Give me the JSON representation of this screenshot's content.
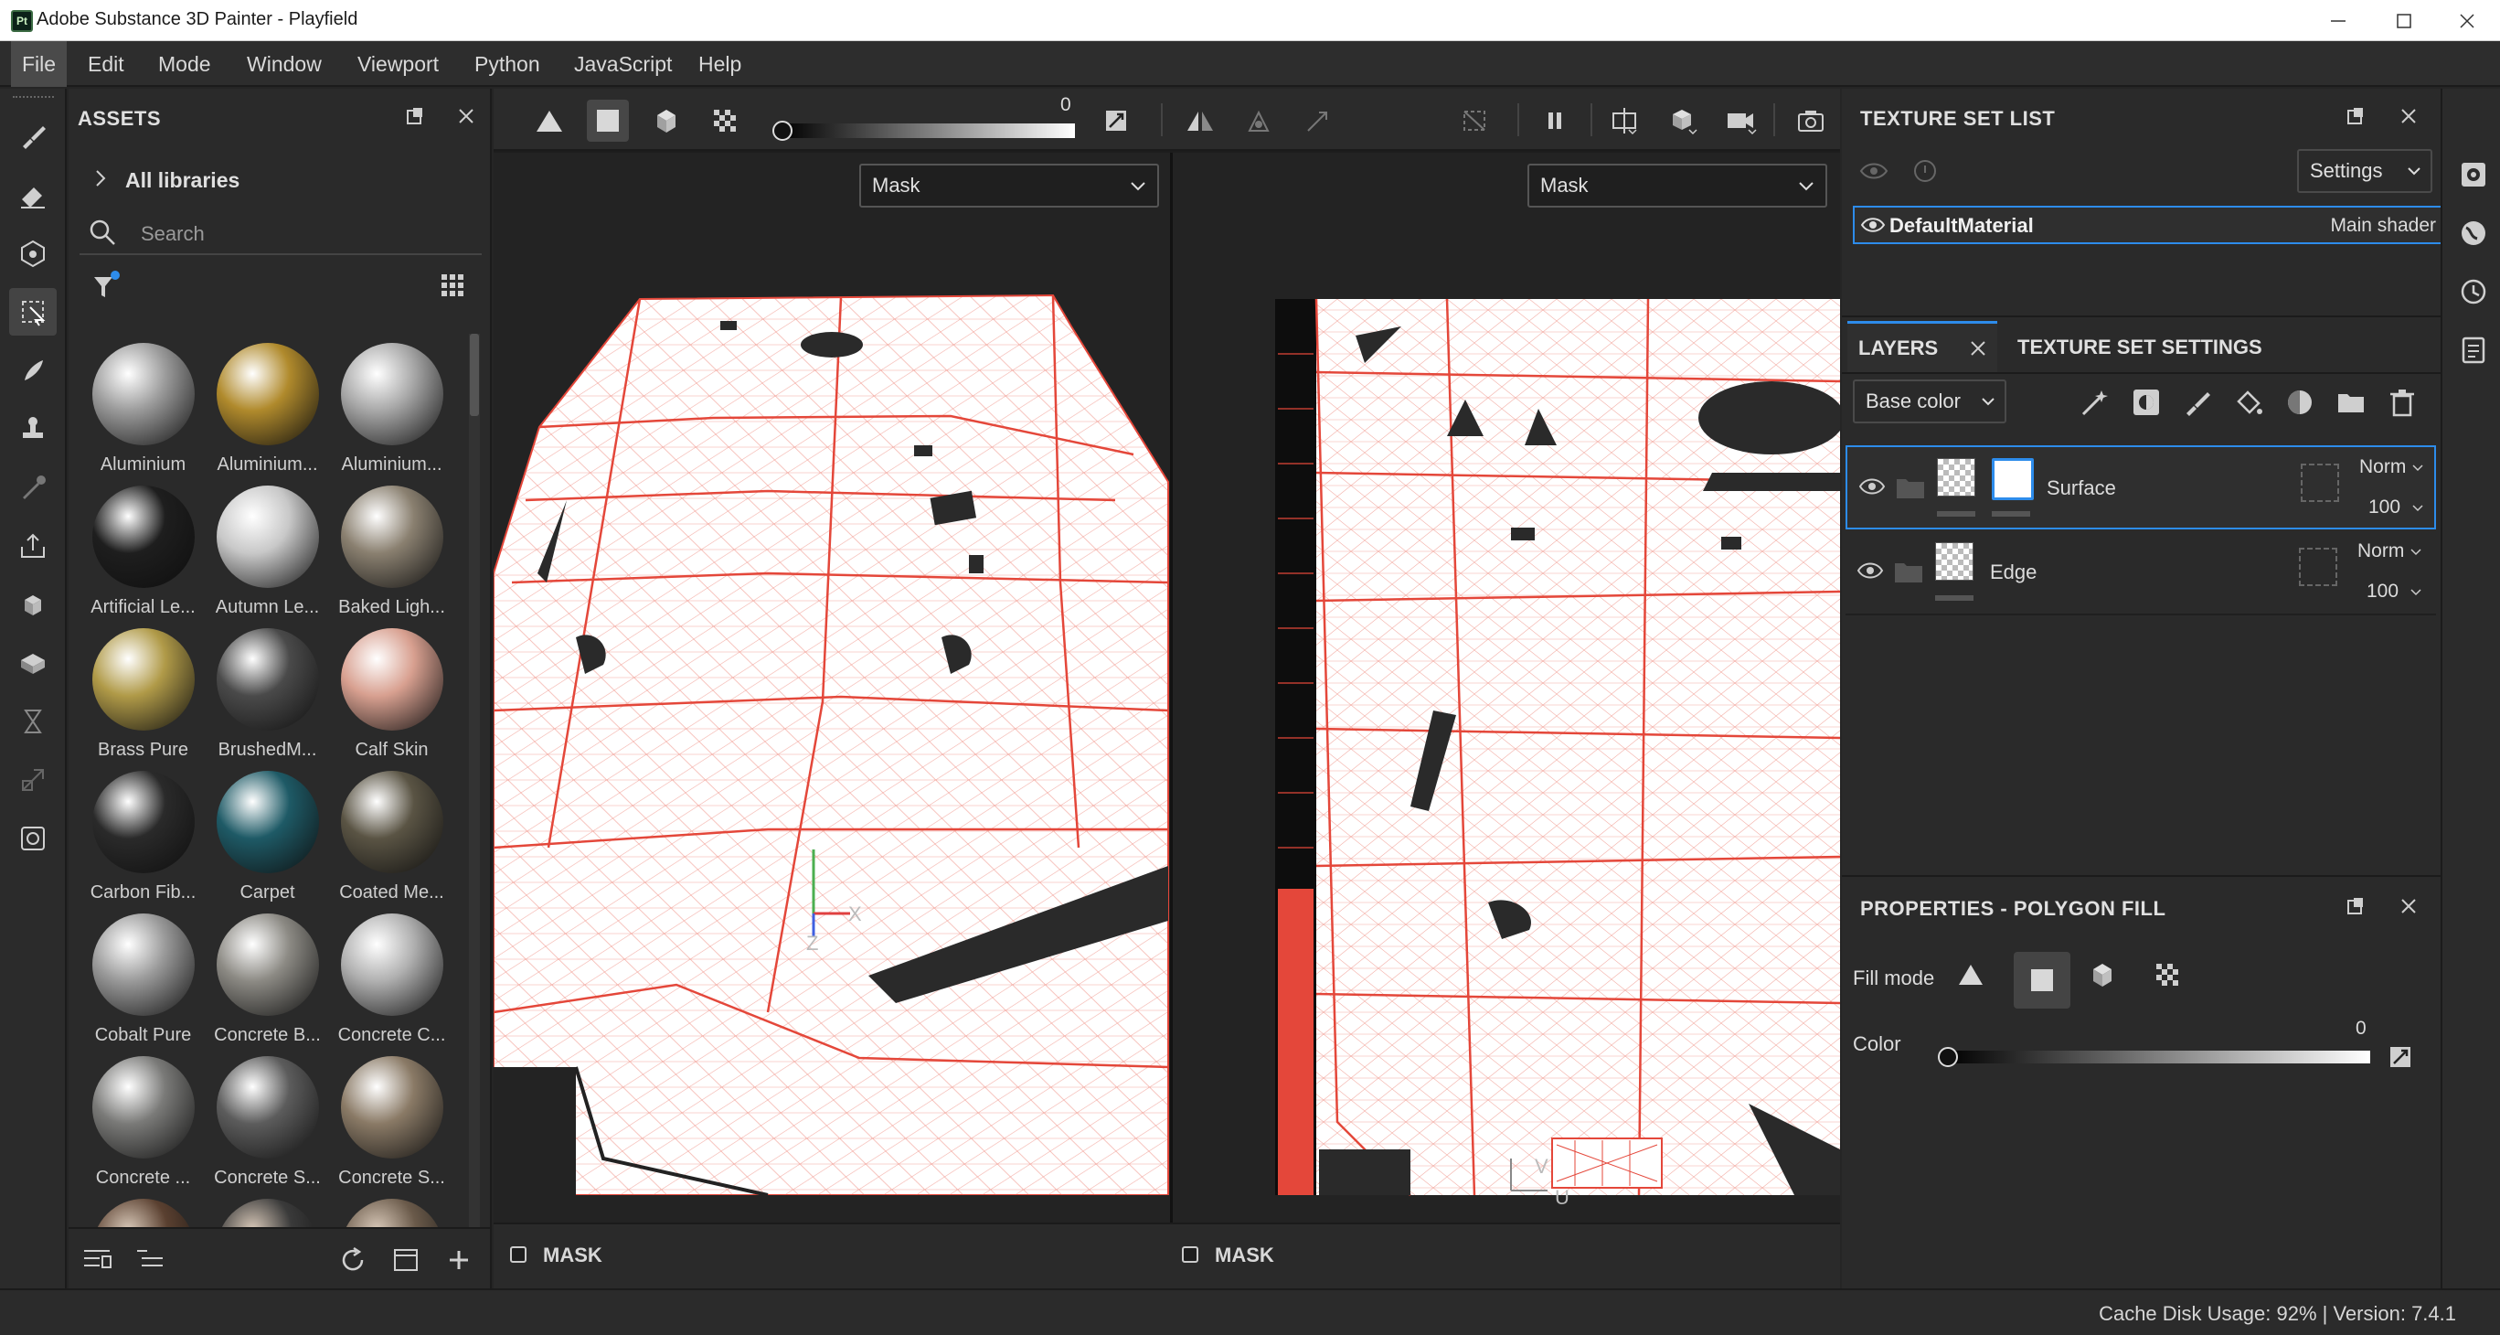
{
  "window": {
    "title": "Adobe Substance 3D Painter - Playfield",
    "app_icon_text": "Pt"
  },
  "menu": [
    "File",
    "Edit",
    "Mode",
    "Window",
    "Viewport",
    "Python",
    "JavaScript",
    "Help"
  ],
  "assets": {
    "title": "ASSETS",
    "libraries_label": "All libraries",
    "search_placeholder": "Search",
    "materials": [
      {
        "name": "Aluminium",
        "color": "#9c9c9c"
      },
      {
        "name": "Aluminium...",
        "color": "#b08a2c"
      },
      {
        "name": "Aluminium...",
        "color": "#a8a8a8"
      },
      {
        "name": "Artificial Le...",
        "color": "#1e1e1e"
      },
      {
        "name": "Autumn Le...",
        "color": "#c8c8c8"
      },
      {
        "name": "Baked Ligh...",
        "color": "#8a8070"
      },
      {
        "name": "Brass Pure",
        "color": "#b09a48"
      },
      {
        "name": "BrushedM...",
        "color": "#4a4a4a"
      },
      {
        "name": "Calf Skin",
        "color": "#d8a090"
      },
      {
        "name": "Carbon Fib...",
        "color": "#2a2a2a"
      },
      {
        "name": "Carpet",
        "color": "#1e5a66"
      },
      {
        "name": "Coated Me...",
        "color": "#5a5444"
      },
      {
        "name": "Cobalt Pure",
        "color": "#9a9a9a"
      },
      {
        "name": "Concrete B...",
        "color": "#8c8a84"
      },
      {
        "name": "Concrete C...",
        "color": "#b0b0b0"
      },
      {
        "name": "Concrete ...",
        "color": "#7a7a78"
      },
      {
        "name": "Concrete S...",
        "color": "#5c5c5c"
      },
      {
        "name": "Concrete S...",
        "color": "#8a7a66"
      }
    ]
  },
  "viewport": {
    "slider_value": "0",
    "left_dropdown": "Mask",
    "right_dropdown": "Mask",
    "left_footer": "MASK",
    "right_footer": "MASK",
    "axis_left": {
      "x": "X",
      "z": "Z"
    },
    "axis_right": {
      "v": "V",
      "u": "U"
    }
  },
  "texture_set_list": {
    "title": "TEXTURE SET LIST",
    "settings_label": "Settings",
    "material_name": "DefaultMaterial",
    "shader_name": "Main shader"
  },
  "layers": {
    "tab_layers": "LAYERS",
    "tab_texture_settings": "TEXTURE SET SETTINGS",
    "channel": "Base color",
    "items": [
      {
        "name": "Surface",
        "blend": "Norm",
        "opacity": "100"
      },
      {
        "name": "Edge",
        "blend": "Norm",
        "opacity": "100"
      }
    ]
  },
  "properties": {
    "title": "PROPERTIES - POLYGON FILL",
    "fill_mode_label": "Fill mode",
    "color_label": "Color",
    "color_value": "0"
  },
  "status": {
    "text": "Cache Disk Usage: 92% | Version: 7.4.1"
  },
  "colors": {
    "accent": "#2d8ceb",
    "uv_red": "#e4473a",
    "titlebar_bg": "#ffffff"
  }
}
